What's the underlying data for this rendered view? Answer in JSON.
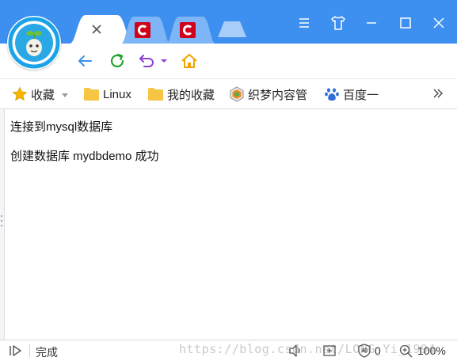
{
  "tabs": [
    {
      "label": "",
      "close_icon": "close-icon",
      "active": true
    },
    {
      "favicon": "c-logo-icon",
      "favicon_color": "#d0021b"
    },
    {
      "favicon": "c-logo-icon",
      "favicon_color": "#d0021b"
    }
  ],
  "window_controls": [
    "menu-icon",
    "skin-icon",
    "minimize-icon",
    "maximize-icon",
    "close-icon"
  ],
  "nav": {
    "icons": [
      "back-icon",
      "refresh-icon",
      "undo-icon",
      "home-icon"
    ],
    "colors": {
      "back": "#3d8ff0",
      "refresh": "#22a32e",
      "undo": "#8e3fd6",
      "home": "#f0a400"
    }
  },
  "bookmarks": {
    "favorites_label": "收藏",
    "items": [
      {
        "label": "Linux",
        "icon": "folder-icon"
      },
      {
        "label": "我的收藏",
        "icon": "folder-icon"
      },
      {
        "label": "织梦内容管",
        "icon": "dedecms-icon"
      },
      {
        "label": "百度一",
        "icon": "baidu-paw-icon"
      }
    ],
    "more_icon": "double-chevron-right-icon"
  },
  "page": {
    "lines": [
      "连接到mysql数据库",
      "创建数据库 mydbdemo 成功"
    ]
  },
  "status": {
    "text": "完成",
    "watermark": "https://blog.csdn.net/LONG_Yi_1994",
    "ad_count": "0",
    "zoom": "100%"
  },
  "colors": {
    "titlebar": "#3d8ff0",
    "folder": "#f7c544"
  }
}
